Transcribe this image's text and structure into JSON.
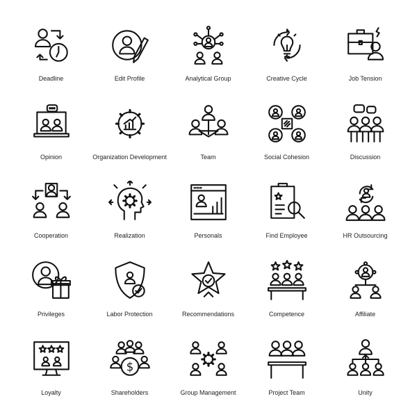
{
  "stroke_color": "#111111",
  "icons": [
    {
      "label": "Deadline",
      "icon": "deadline-icon"
    },
    {
      "label": "Edit Profile",
      "icon": "edit-profile-icon"
    },
    {
      "label": "Analytical Group",
      "icon": "analytical-group-icon"
    },
    {
      "label": "Creative Cycle",
      "icon": "creative-cycle-icon"
    },
    {
      "label": "Job Tension",
      "icon": "job-tension-icon"
    },
    {
      "label": "Opinion",
      "icon": "opinion-icon"
    },
    {
      "label": "Organization Development",
      "icon": "organization-development-icon"
    },
    {
      "label": "Team",
      "icon": "team-icon"
    },
    {
      "label": "Social Cohesion",
      "icon": "social-cohesion-icon"
    },
    {
      "label": "Discussion",
      "icon": "discussion-icon"
    },
    {
      "label": "Cooperation",
      "icon": "cooperation-icon"
    },
    {
      "label": "Realization",
      "icon": "realization-icon"
    },
    {
      "label": "Personals",
      "icon": "personals-icon"
    },
    {
      "label": "Find Employee",
      "icon": "find-employee-icon"
    },
    {
      "label": "HR Outsourcing",
      "icon": "hr-outsourcing-icon"
    },
    {
      "label": "Privileges",
      "icon": "privileges-icon"
    },
    {
      "label": "Labor Protection",
      "icon": "labor-protection-icon"
    },
    {
      "label": "Recommendations",
      "icon": "recommendations-icon"
    },
    {
      "label": "Competence",
      "icon": "competence-icon"
    },
    {
      "label": "Affiliate",
      "icon": "affiliate-icon"
    },
    {
      "label": "Loyalty",
      "icon": "loyalty-icon"
    },
    {
      "label": "Shareholders",
      "icon": "shareholders-icon"
    },
    {
      "label": "Group Management",
      "icon": "group-management-icon"
    },
    {
      "label": "Project Team",
      "icon": "project-team-icon"
    },
    {
      "label": "Unity",
      "icon": "unity-icon"
    }
  ]
}
